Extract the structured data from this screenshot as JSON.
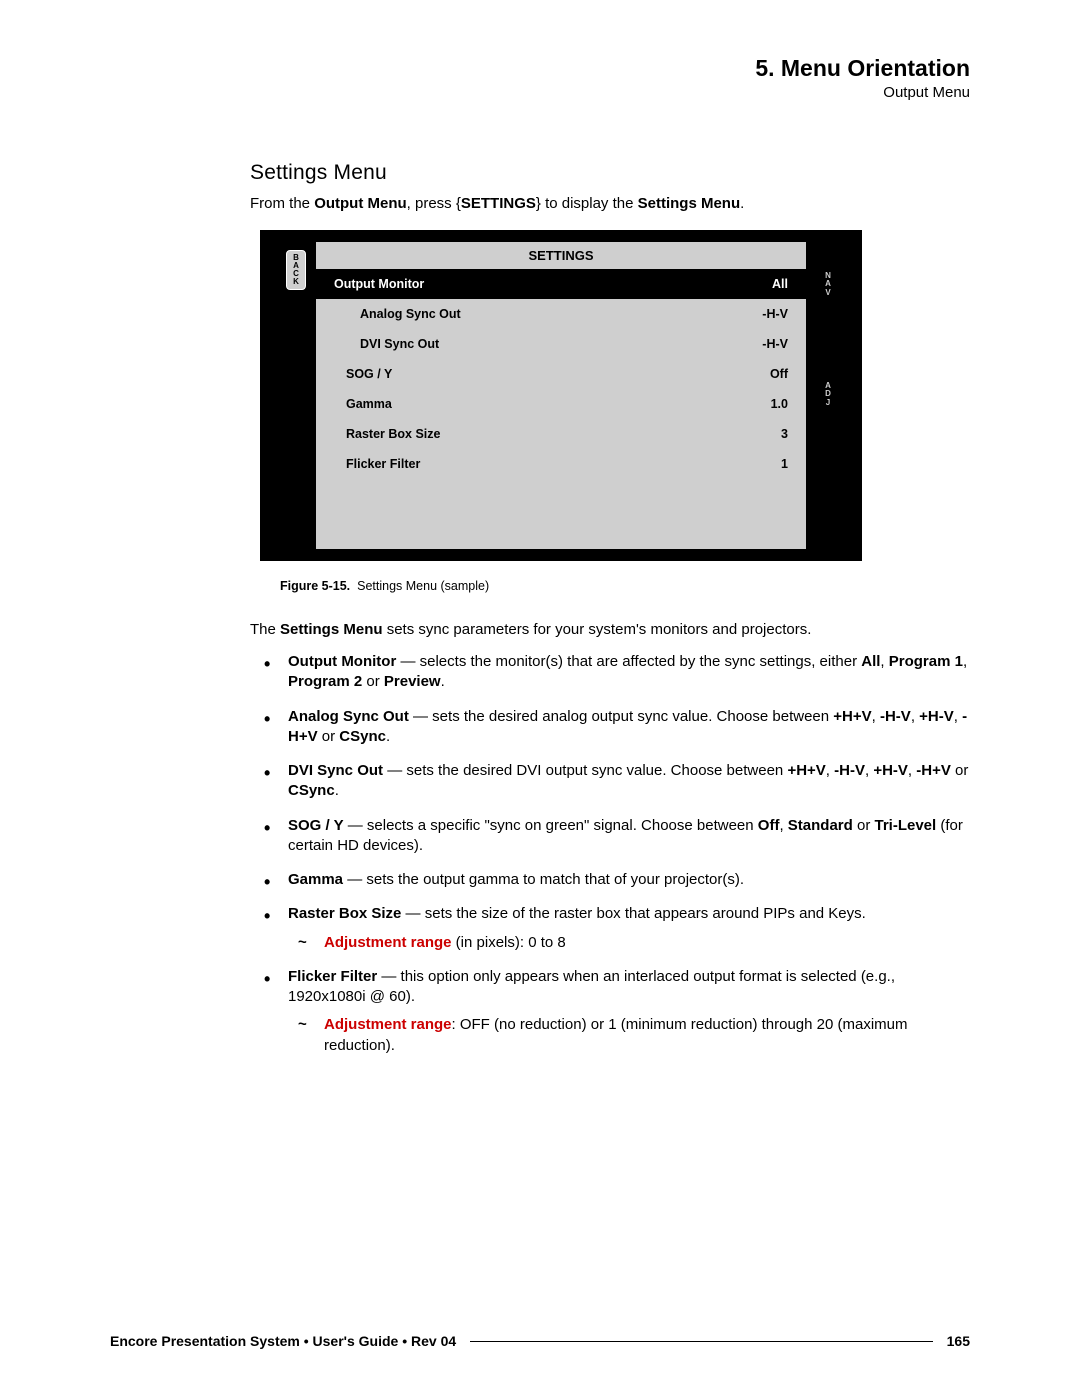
{
  "header": {
    "chapter": "5.  Menu Orientation",
    "subtitle": "Output Menu"
  },
  "section_heading": "Settings Menu",
  "intro": {
    "pre": "From the ",
    "b1": "Output Menu",
    "mid": ", press {",
    "b2": "SETTINGS",
    "post": "} to display the ",
    "b3": "Settings Menu",
    "end": "."
  },
  "menu": {
    "back": [
      "B",
      "A",
      "C",
      "K"
    ],
    "title": "SETTINGS",
    "rows": [
      {
        "label": "Output Monitor",
        "value": "All",
        "selected": true,
        "indent": false
      },
      {
        "label": "Analog Sync Out",
        "value": "-H-V",
        "selected": false,
        "indent": true
      },
      {
        "label": "DVI Sync Out",
        "value": "-H-V",
        "selected": false,
        "indent": true
      },
      {
        "label": "SOG / Y",
        "value": "Off",
        "selected": false,
        "indent": false
      },
      {
        "label": "Gamma",
        "value": "1.0",
        "selected": false,
        "indent": false
      },
      {
        "label": "Raster Box Size",
        "value": "3",
        "selected": false,
        "indent": false
      },
      {
        "label": "Flicker Filter",
        "value": "1",
        "selected": false,
        "indent": false
      }
    ],
    "nav": [
      "N",
      "A",
      "V"
    ],
    "adj": [
      "A",
      "D",
      "J"
    ]
  },
  "figure": {
    "label": "Figure 5-15.",
    "caption": "Settings Menu  (sample)"
  },
  "desc_para": {
    "pre": "The ",
    "b": "Settings Menu",
    "post": " sets sync parameters for your system's monitors and projectors."
  },
  "bullets": {
    "b1": {
      "t1": "Output Monitor",
      "t2": " — selects the monitor(s) that are affected by the sync settings, either ",
      "t3": "All",
      "t4": ", ",
      "t5": "Program 1",
      "t6": ", ",
      "t7": "Program 2",
      "t8": " or ",
      "t9": "Preview",
      "t10": "."
    },
    "b2": {
      "t1": "Analog Sync Out",
      "t2": " — sets the desired analog output sync value.  Choose between ",
      "t3": "+H+V",
      "t4": ", ",
      "t5": "-H-V",
      "t6": ", ",
      "t7": "+H-V",
      "t8": ", ",
      "t9": "-H+V",
      "t10": " or ",
      "t11": "CSync",
      "t12": "."
    },
    "b3": {
      "t1": "DVI Sync Out",
      "t2": " — sets the desired DVI output sync value.  Choose between ",
      "t3": "+H+V",
      "t4": ", ",
      "t5": "-H-V",
      "t6": ", ",
      "t7": "+H-V",
      "t8": ", ",
      "t9": "-H+V",
      "t10": " or ",
      "t11": "CSync",
      "t12": "."
    },
    "b4": {
      "t1": "SOG / Y",
      "t2": " — selects a specific \"sync on green\" signal.  Choose between ",
      "t3": "Off",
      "t4": ", ",
      "t5": "Standard",
      "t6": " or ",
      "t7": "Tri-Level",
      "t8": " (for certain HD devices)."
    },
    "b5": {
      "t1": "Gamma",
      "t2": " — sets the output gamma to match that of your projector(s)."
    },
    "b6": {
      "t1": "Raster Box Size",
      "t2": " — sets the size of the raster box that appears around PIPs and Keys.",
      "sub_red": "Adjustment range",
      "sub_rest": " (in pixels):  0 to 8"
    },
    "b7": {
      "t1": "Flicker Filter",
      "t2": " — this option only appears when an interlaced output format is selected (e.g., 1920x1080i @ 60).",
      "sub_red": "Adjustment range",
      "sub_rest": ":  OFF (no reduction) or 1 (minimum reduction) through 20 (maximum reduction)."
    }
  },
  "footer": {
    "text": "Encore Presentation System  •  User's Guide  •  Rev 04",
    "page": "165"
  }
}
